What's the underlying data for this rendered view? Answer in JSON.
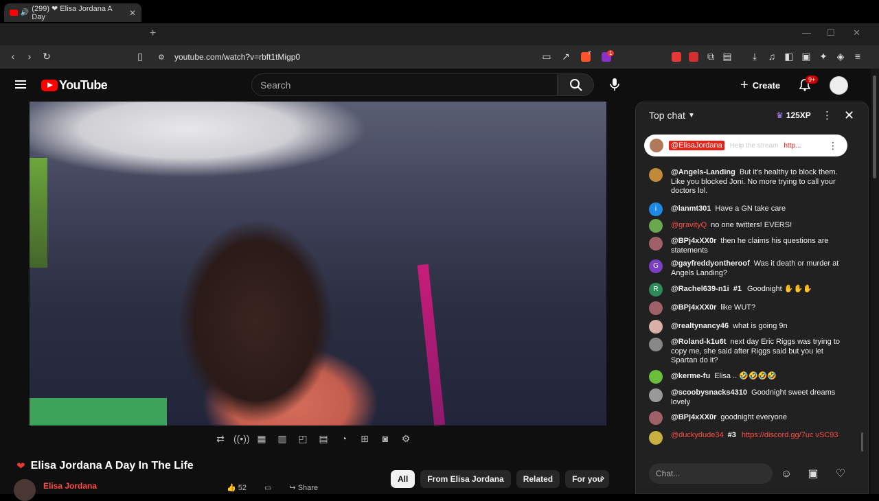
{
  "browser": {
    "tab_title": "(299) ❤ Elisa Jordana A Day",
    "url": "youtube.com/watch?v=rbft1tMigp0",
    "new_tab": "+",
    "extension_badge_brave": "7",
    "extension_badge_alert": "1"
  },
  "youtube": {
    "logo_text": "YouTube",
    "search_placeholder": "Search",
    "create_label": "Create",
    "notif_count": "9+"
  },
  "video": {
    "title": "Elisa Jordana A Day In The Life",
    "channel": "Elisa Jordana",
    "like_count": "52",
    "share_label": "Share"
  },
  "chips": [
    "All",
    "From Elisa Jordana",
    "Related",
    "For you"
  ],
  "chat": {
    "header": "Top chat",
    "xp": "125XP",
    "pinned": {
      "author": "@ElisaJordana",
      "text": "Help the stream",
      "link": "http..."
    },
    "messages": [
      {
        "author": "@Angels-Landing",
        "text": "But it's healthy to block them. Like you blocked Joni. No more trying to call your doctors lol.",
        "avatar_color": "#c08a3a",
        "initial": ""
      },
      {
        "author": "@lanmt301",
        "text": "Have a GN take care",
        "avatar_color": "#1e88e5",
        "initial": "i"
      },
      {
        "author": "@gravityQ",
        "text": "no one twitters! EVERS!",
        "avatar_color": "#6aa84f",
        "initial": ""
      },
      {
        "author": "@BPj4xXX0r",
        "text": "then he claims his questions are statements",
        "avatar_color": "#a0606a",
        "initial": ""
      },
      {
        "author": "@gayfreddyontheroof",
        "text": "Was it death or murder at Angels Landing?",
        "avatar_color": "#7b3fc4",
        "initial": "G"
      },
      {
        "author": "@Rachel639-n1i",
        "badge": "#1",
        "text": "Goodnight ✋✋✋",
        "avatar_color": "#2e8b57",
        "initial": "R"
      },
      {
        "author": "@BPj4xXX0r",
        "text": "like WUT?",
        "avatar_color": "#a0606a",
        "initial": ""
      },
      {
        "author": "@realtynancy46",
        "text": "what is going 9n",
        "avatar_color": "#d8b0a8",
        "initial": ""
      },
      {
        "author": "@Roland-k1u6t",
        "text": "next day Eric Riggs was trying to copy me, she said after Riggs said but you let Spartan do it?",
        "avatar_color": "#888888",
        "initial": ""
      },
      {
        "author": "@kerme-fu",
        "text": "Elisa .. 🤣🤣🤣🤣",
        "avatar_color": "#6bbf3a",
        "initial": ""
      },
      {
        "author": "@scoobysnacks4310",
        "text": "Goodnight sweet dreams lovely",
        "avatar_color": "#999999",
        "initial": ""
      },
      {
        "author": "@BPj4xXX0r",
        "text": "goodnight everyone",
        "avatar_color": "#a0606a",
        "initial": ""
      },
      {
        "author": "@duckydude34",
        "badge": "#3",
        "text": "",
        "link": "https://discord.gg/7uc vSC93",
        "avatar_color": "#c8b040",
        "initial": ""
      }
    ],
    "input_placeholder": "Chat..."
  }
}
